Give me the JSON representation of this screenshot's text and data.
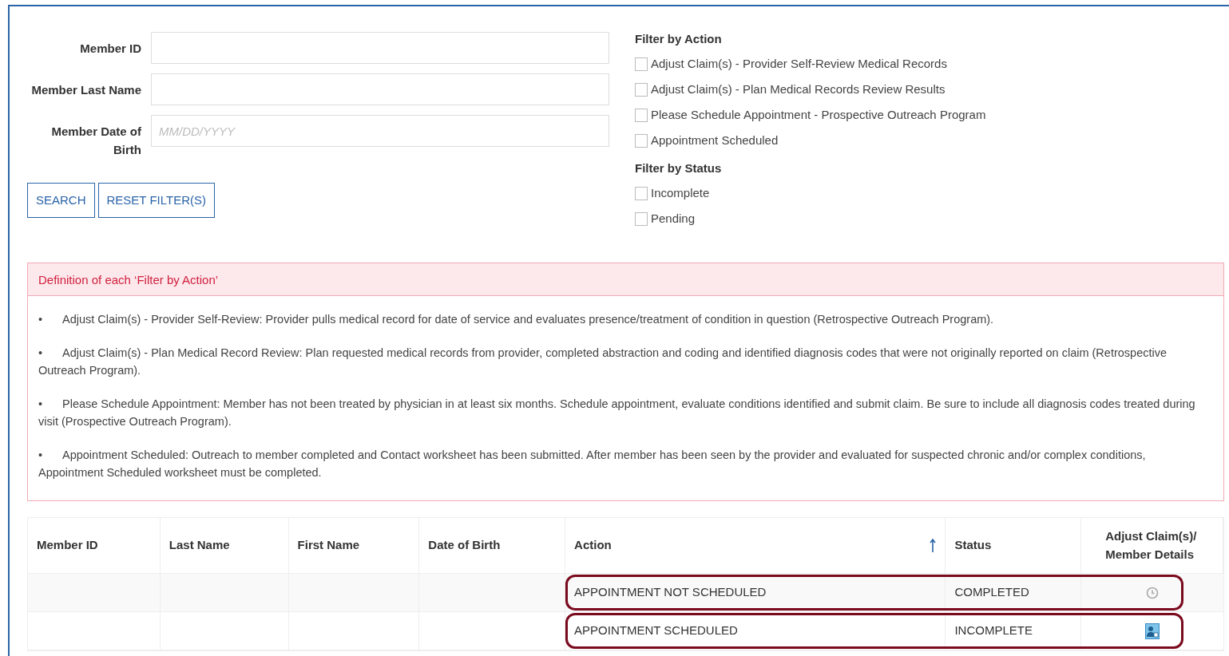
{
  "search_form": {
    "fields": [
      {
        "label": "Member ID"
      },
      {
        "label": "Member Last Name"
      },
      {
        "label": "Member Date of Birth",
        "placeholder": "MM/DD/YYYY"
      }
    ],
    "buttons": [
      "SEARCH",
      "RESET FILTER(S)"
    ]
  },
  "filters": [
    {
      "title": "Filter by Action",
      "options": [
        {
          "label": "Adjust Claim(s) - Provider Self-Review Medical Records",
          "checked": false
        },
        {
          "label": "Adjust Claim(s) - Plan Medical Records Review Results",
          "checked": false
        },
        {
          "label": "Please Schedule Appointment - Prospective Outreach Program",
          "checked": false
        },
        {
          "label": "Appointment Scheduled",
          "checked": false
        }
      ]
    },
    {
      "title": "Filter by Status",
      "options": [
        {
          "label": "Incomplete",
          "checked": false
        },
        {
          "label": "Pending",
          "checked": false
        }
      ]
    }
  ],
  "definitions": {
    "title": "Definition of each ‘Filter by Action’",
    "bullet": "•",
    "items": [
      "Adjust Claim(s) - Provider Self-Review:  Provider pulls medical record for date of service and evaluates presence/treatment of condition in question (Retrospective Outreach Program).",
      "Adjust Claim(s) - Plan Medical Record Review: Plan requested medical records from provider, completed abstraction and coding and identified diagnosis codes that were not originally reported on claim (Retrospective Outreach Program).",
      "Please Schedule Appointment: Member has not been treated by physician in at least six months.  Schedule appointment, evaluate conditions identified and submit claim. Be sure to include all diagnosis codes treated during visit (Prospective Outreach Program).",
      "Appointment Scheduled: Outreach to member completed and Contact worksheet has been submitted. After member has been seen by the provider and evaluated for suspected chronic and/or complex conditions, Appointment Scheduled worksheet must be completed."
    ]
  },
  "table": {
    "columns": [
      {
        "label": "Member ID",
        "sorted": false
      },
      {
        "label": "Last Name",
        "sorted": false
      },
      {
        "label": "First Name",
        "sorted": false
      },
      {
        "label": "Date of Birth",
        "sorted": false
      },
      {
        "label": "Action",
        "sorted": true
      },
      {
        "label": "Status",
        "sorted": false
      },
      {
        "label": "Adjust Claim(s)/ Member Details",
        "sorted": false
      }
    ],
    "rows": [
      {
        "action": "APPOINTMENT NOT SCHEDULED",
        "status": "COMPLETED",
        "icon": {
          "kind": "clock"
        },
        "highlighted": true
      },
      {
        "action": "APPOINTMENT SCHEDULED",
        "status": "INCOMPLETE",
        "icon": {
          "kind": "member"
        },
        "highlighted": true
      }
    ]
  }
}
